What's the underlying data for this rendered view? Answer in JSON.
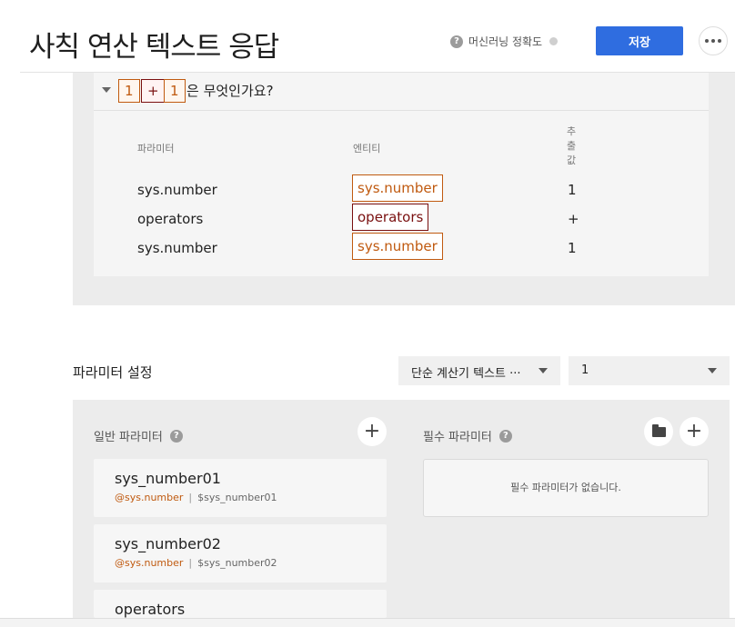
{
  "header": {
    "title": "사칙 연산 텍스트 응답",
    "ml_accuracy_label": "머신러닝 정확도",
    "save_label": "저장"
  },
  "utterance": {
    "tokens": [
      "1",
      "+",
      "1"
    ],
    "suffix": "은 무엇인가요?"
  },
  "extraction_table": {
    "headers": [
      "파라미터",
      "엔티티",
      "추\n출\n값"
    ],
    "rows": [
      {
        "parameter": "sys.number",
        "entity": "sys.number",
        "value": "1"
      },
      {
        "parameter": "operators",
        "entity": "operators",
        "value": "+"
      },
      {
        "parameter": "sys.number",
        "entity": "sys.number",
        "value": "1"
      }
    ]
  },
  "param_settings": {
    "title": "파라미터 설정",
    "response_select": "단순 계산기 텍스트 ···",
    "count_select": "1",
    "general_title": "일반 파라미터",
    "required_title": "필수 파라미터",
    "required_empty": "필수 파라미터가 없습니다.",
    "general_params": [
      {
        "name": "sys_number01",
        "entity": "@sys.number",
        "variable": "$sys_number01"
      },
      {
        "name": "sys_number02",
        "entity": "@sys.number",
        "variable": "$sys_number02"
      },
      {
        "name": "operators",
        "entity": "",
        "variable": ""
      }
    ]
  },
  "colors": {
    "accent": "#2f6de0",
    "number_entity": "#c05a10",
    "operator_entity": "#7a1010"
  }
}
